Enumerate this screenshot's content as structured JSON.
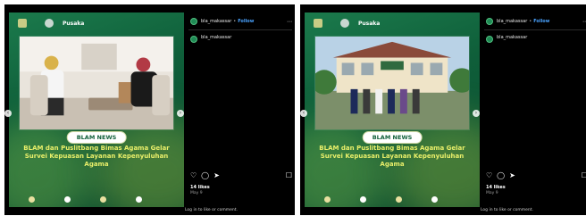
{
  "panels": [
    {
      "logo_text": "",
      "logo_brand": "Pusaka",
      "badge": "BLAM NEWS",
      "headline": "BLAM dan Puslitbang Bimas Agama Gelar Survei Kepuasan Layanan Kepenyuluhan Agama",
      "subline": "",
      "username": "bla_makassar",
      "follow": "Follow",
      "caption_user": "bla_makassar",
      "likes": "14 likes",
      "date": "May 9",
      "login": "Log in to like or comment."
    },
    {
      "logo_text": "",
      "logo_brand": "Pusaka",
      "badge": "BLAM NEWS",
      "headline": "BLAM dan Puslitbang Bimas Agama Gelar Survei Kepuasan Layanan Kepenyuluhan Agama",
      "subline": "",
      "username": "bla_makassar",
      "follow": "Follow",
      "caption_user": "bla_makassar",
      "likes": "14 likes",
      "date": "May 9",
      "login": "Log in to like or comment."
    }
  ],
  "icons": {
    "prev": "chevron-left-icon",
    "next": "chevron-right-icon",
    "more": "more-horizontal-icon",
    "like": "heart-icon",
    "comment": "comment-icon",
    "share": "send-icon",
    "save": "bookmark-icon"
  },
  "colors": {
    "panel_bg": "#000000",
    "post_green": "#0f5f3a",
    "headline_yellow": "#e9ef6a",
    "follow_blue": "#4aa3ff"
  }
}
